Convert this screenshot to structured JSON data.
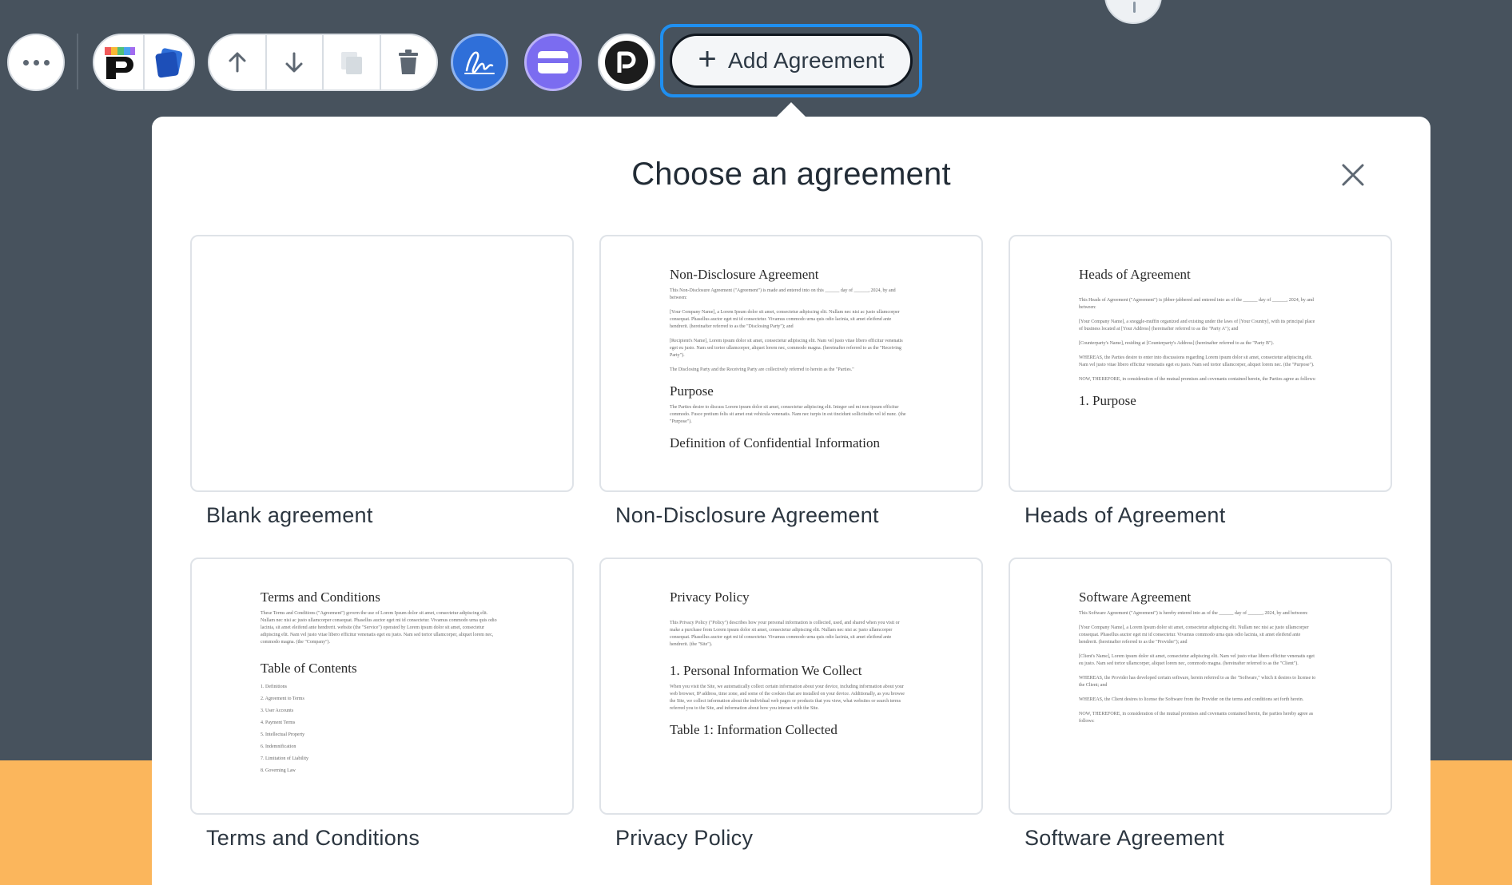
{
  "toolbar": {
    "add_agreement_label": "Add Agreement",
    "icons": [
      "more-icon",
      "palette-app-icon",
      "blue-cards-app-icon",
      "arrow-up-icon",
      "arrow-down-icon",
      "duplicate-icon",
      "trash-icon",
      "signature-icon",
      "credit-card-icon",
      "p-logo-icon"
    ],
    "colors": {
      "sign": "#2f6fd9",
      "card": "#7b6cf0",
      "highlight": "#1f8ff0"
    }
  },
  "panel": {
    "title": "Choose an agreement",
    "close_icon": "close-icon"
  },
  "agreements": [
    {
      "label": "Blank agreement",
      "preview": null
    },
    {
      "label": "Non-Disclosure Agreement",
      "preview": {
        "title": "Non-Disclosure Agreement",
        "paragraphs": [
          "This Non-Disclosure Agreement (\"Agreement\") is made and entered into on this ______ day of ______, 2024, by and between:",
          "[Your Company Name], a Lorem Ipsum dolor sit amet, consectetur adipiscing elit. Nullam nec nisi ac justo ullamcorper consequat. Phasellus auctor eget mi id consectetur. Vivamus commodo urna quis odio lacinia, sit amet eleifend ante hendrerit. (hereinafter referred to as the \"Disclosing Party\"); and",
          "[Recipient's Name], Lorem ipsum dolor sit amet, consectetur adipiscing elit. Nam vel justo vitae libero efficitur venenatis eget eu justo. Nam sed tortor ullamcorper, aliquet lorem nec, commodo magna. (hereinafter referred to as the \"Receiving Party\").",
          "The Disclosing Party and the Receiving Party are collectively referred to herein as the \"Parties.\""
        ],
        "heading2": "Purpose",
        "paragraphs2": [
          "The Parties desire to discuss Lorem ipsum dolor sit amet, consectetur adipiscing elit. Integer sed mi non ipsum efficitur commodo. Fusce pretium felis sit amet erat vehicula venenatis. Nam nec turpis in est tincidunt sollicitudin vel id nunc. (the \"Purpose\")."
        ],
        "heading3": "Definition of Confidential Information"
      }
    },
    {
      "label": "Heads of Agreement",
      "preview": {
        "title": "Heads of Agreement",
        "paragraphs": [
          "This Heads of Agreement (\"Agreement\") is jibber-jabbered and entered into as of the ______ day of ______, 2024, by and between:",
          "[Your Company Name], a snoggle-muffin organized and existing under the laws of [Your Country], with its principal place of business located at [Your Address] (hereinafter referred to as the \"Party A\"); and",
          "[Counterparty's Name], residing at [Counterparty's Address] (hereinafter referred to as the \"Party B\").",
          "WHEREAS, the Parties desire to enter into discussions regarding Lorem ipsum dolor sit amet, consectetur adipiscing elit. Nam vel justo vitae libero efficitur venenatis eget eu justo. Nam sed tortor ullamcorper, aliquet lorem nec. (the \"Purpose\").",
          "NOW, THEREFORE, in consideration of the mutual promises and covenants contained herein, the Parties agree as follows:"
        ],
        "heading2": "1. Purpose"
      }
    },
    {
      "label": "Terms and Conditions",
      "preview": {
        "title": "Terms and Conditions",
        "paragraphs": [
          "These Terms and Conditions (\"Agreement\") govern the use of Lorem Ipsum dolor sit amet, consectetur adipiscing elit. Nullam nec nisi ac justo ullamcorper consequat. Phasellus auctor eget mi id consectetur. Vivamus commodo urna quis odio lacinia, sit amet eleifend ante hendrerit. website (the \"Service\") operated by Lorem ipsum dolor sit amet, consectetur adipiscing elit. Nam vel justo vitae libero efficitur venenatis eget eu justo. Nam sed tortor ullamcorper, aliquet lorem nec, commodo magna. (the \"Company\")."
        ],
        "heading2": "Table of Contents",
        "list": [
          "1. Definitions",
          "2. Agreement to Terms",
          "3. User Accounts",
          "4. Payment Terms",
          "5. Intellectual Property",
          "6. Indemnification",
          "7. Limitation of Liability",
          "8. Governing Law"
        ]
      }
    },
    {
      "label": "Privacy Policy",
      "preview": {
        "title": "Privacy Policy",
        "paragraphs": [
          "This Privacy Policy (\"Policy\") describes how your personal information is collected, used, and shared when you visit or make a purchase from Lorem ipsum dolor sit amet, consectetur adipiscing elit. Nullam nec nisi ac justo ullamcorper consequat. Phasellus auctor eget mi id consectetur. Vivamus commodo urna quis odio lacinia, sit amet eleifend ante hendrerit. (the \"Site\")."
        ],
        "heading2": "1. Personal Information We Collect",
        "paragraphs2": [
          "When you visit the Site, we automatically collect certain information about your device, including information about your web browser, IP address, time zone, and some of the cookies that are installed on your device. Additionally, as you browse the Site, we collect information about the individual web pages or products that you view, what websites or search terms referred you to the Site, and information about how you interact with the Site."
        ],
        "heading3": "Table 1: Information Collected"
      }
    },
    {
      "label": "Software Agreement",
      "preview": {
        "title": "Software Agreement",
        "paragraphs": [
          "This Software Agreement (\"Agreement\") is hereby entered into as of the ______ day of ______, 2024, by and between:",
          "[Your Company Name], a Lorem Ipsum dolor sit amet, consectetur adipiscing elit. Nullam nec nisi ac justo ullamcorper consequat. Phasellus auctor eget mi id consectetur. Vivamus commodo urna quis odio lacinia, sit amet eleifend ante hendrerit. (hereinafter referred to as the \"Provider\"); and",
          "[Client's Name], Lorem ipsum dolor sit amet, consectetur adipiscing elit. Nam vel justo vitae libero efficitur venenatis eget eu justo. Nam sed tortor ullamcorper, aliquet lorem nec, commodo magna. (hereinafter referred to as the \"Client\").",
          "WHEREAS, the Provider has developed certain software, herein referred to as the \"Software,\" which it desires to license to the Client; and",
          "WHEREAS, the Client desires to license the Software from the Provider on the terms and conditions set forth herein.",
          "NOW, THEREFORE, in consideration of the mutual promises and covenants contained herein, the parties hereby agree as follows:"
        ]
      }
    }
  ]
}
